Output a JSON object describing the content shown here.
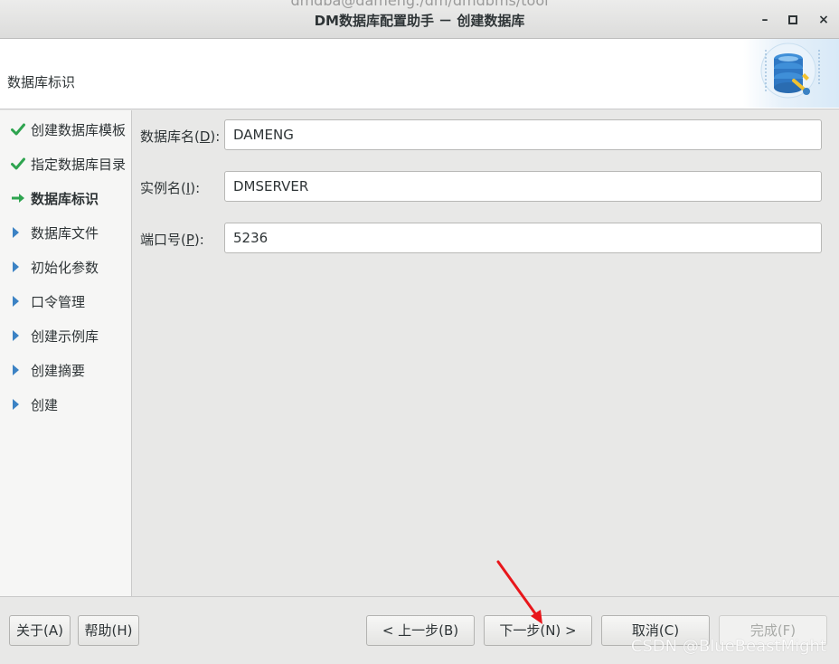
{
  "window": {
    "background_path": "dmdba@dameng:/dm/dmdbms/tool",
    "title": "DM数据库配置助手 － 创建数据库",
    "minimize_glyph": "–",
    "maximize_glyph": "◻",
    "close_glyph": "×"
  },
  "header": {
    "title": "数据库标识"
  },
  "steps": [
    {
      "label": "创建数据库模板",
      "status": "done",
      "icon": "check-icon"
    },
    {
      "label": "指定数据库目录",
      "status": "done",
      "icon": "check-icon"
    },
    {
      "label": "数据库标识",
      "status": "current",
      "icon": "arrow-right-icon"
    },
    {
      "label": "数据库文件",
      "status": "pending",
      "icon": "triangle-right-icon"
    },
    {
      "label": "初始化参数",
      "status": "pending",
      "icon": "triangle-right-icon"
    },
    {
      "label": "口令管理",
      "status": "pending",
      "icon": "triangle-right-icon"
    },
    {
      "label": "创建示例库",
      "status": "pending",
      "icon": "triangle-right-icon"
    },
    {
      "label": "创建摘要",
      "status": "pending",
      "icon": "triangle-right-icon"
    },
    {
      "label": "创建",
      "status": "pending",
      "icon": "triangle-right-icon"
    }
  ],
  "form": {
    "db_name": {
      "label_pre": "数据库名(",
      "mnemonic": "D",
      "label_post": "):",
      "value": "DAMENG"
    },
    "instance_name": {
      "label_pre": "实例名(",
      "mnemonic": "I",
      "label_post": "):",
      "value": "DMSERVER"
    },
    "port": {
      "label_pre": "端口号(",
      "mnemonic": "P",
      "label_post": "):",
      "value": "5236"
    }
  },
  "buttons": {
    "about": "关于(A)",
    "help": "帮助(H)",
    "prev": "< 上一步(B)",
    "next": "下一步(N) >",
    "cancel": "取消(C)",
    "finish": "完成(F)"
  },
  "watermark": "CSDN @BlueBeastMight",
  "colors": {
    "check": "#2ea44f",
    "current_arrow": "#2ea44f",
    "pending_triangle": "#3b82c4",
    "annotation_arrow": "#e8161b"
  }
}
